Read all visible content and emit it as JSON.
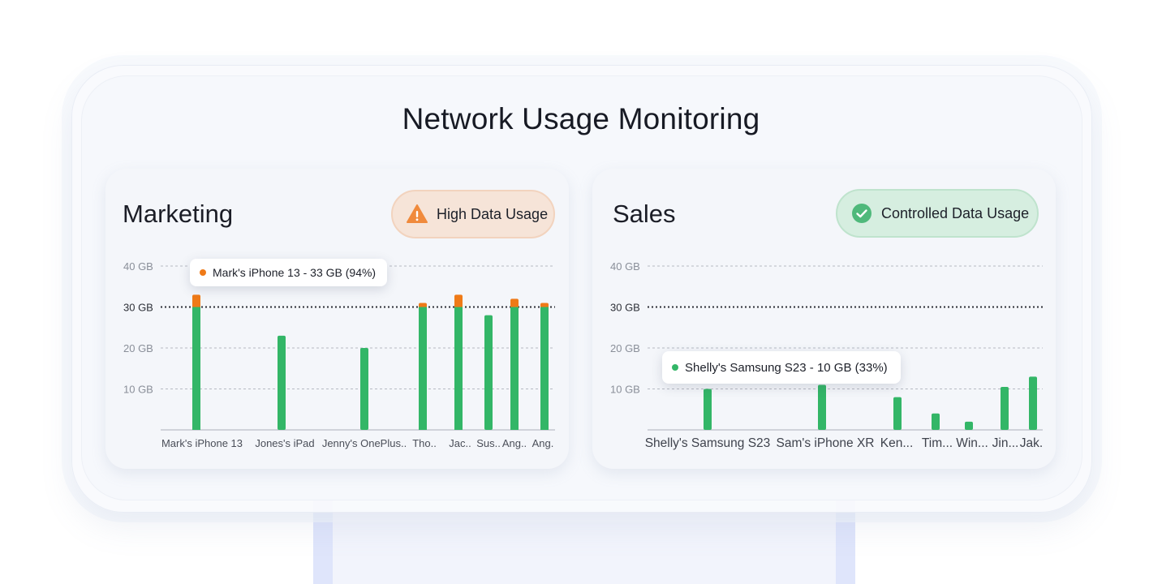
{
  "title": "Network Usage Monitoring",
  "colors": {
    "normal": "#33b667",
    "over": "#ef7a17",
    "grid": "#9ea3ad",
    "threshold": "#2b2e36"
  },
  "cards": [
    {
      "name": "Marketing",
      "badge": {
        "label": "High Data Usage",
        "icon": "warning-icon",
        "status": "warning"
      },
      "tooltip": {
        "text": "Mark's iPhone 13 - 33 GB (94%)",
        "dot_color": "#ef7a17"
      }
    },
    {
      "name": "Sales",
      "badge": {
        "label": "Controlled Data Usage",
        "icon": "check-icon",
        "status": "ok"
      },
      "tooltip": {
        "text": "Shelly's Samsung S23 - 10 GB (33%)",
        "dot_color": "#33b667"
      }
    }
  ],
  "chart_data": [
    {
      "type": "bar",
      "title": "Marketing",
      "ylim": [
        0,
        40
      ],
      "yticks": [
        "10 GB",
        "20 GB",
        "30 GB",
        "40 GB"
      ],
      "threshold": 30,
      "x": [
        "Mark's iPhone 13",
        "Jones's iPad",
        "Jenny's OnePlus..",
        "Tho..",
        "Jac..",
        "Sus..",
        "Ang..",
        "Ang."
      ],
      "xlabels": [
        "Mark's iPhone 13",
        "Jones's iPad",
        "Jenny's OnePlus..",
        "Tho..",
        "Jac..",
        "Sus..",
        "Ang..",
        "Ang."
      ],
      "values": [
        33,
        23,
        20,
        31,
        33,
        28,
        32,
        31
      ],
      "grid": true
    },
    {
      "type": "bar",
      "title": "Sales",
      "ylim": [
        0,
        40
      ],
      "yticks": [
        "10 GB",
        "20 GB",
        "30 GB",
        "40 GB"
      ],
      "threshold": 30,
      "x": [
        "Shelly's Samsung S23",
        "Sam's iPhone XR",
        "Ken...",
        "Tim...",
        "Win...",
        "Jin...",
        "Jak."
      ],
      "xlabels": [
        "Shelly's Samsung S23",
        "Sam's iPhone XR",
        "Ken...",
        "Tim...",
        "Win...",
        "Jin...",
        "Jak."
      ],
      "values": [
        10,
        11,
        8,
        4,
        2,
        10.5,
        13
      ],
      "grid": true
    }
  ]
}
